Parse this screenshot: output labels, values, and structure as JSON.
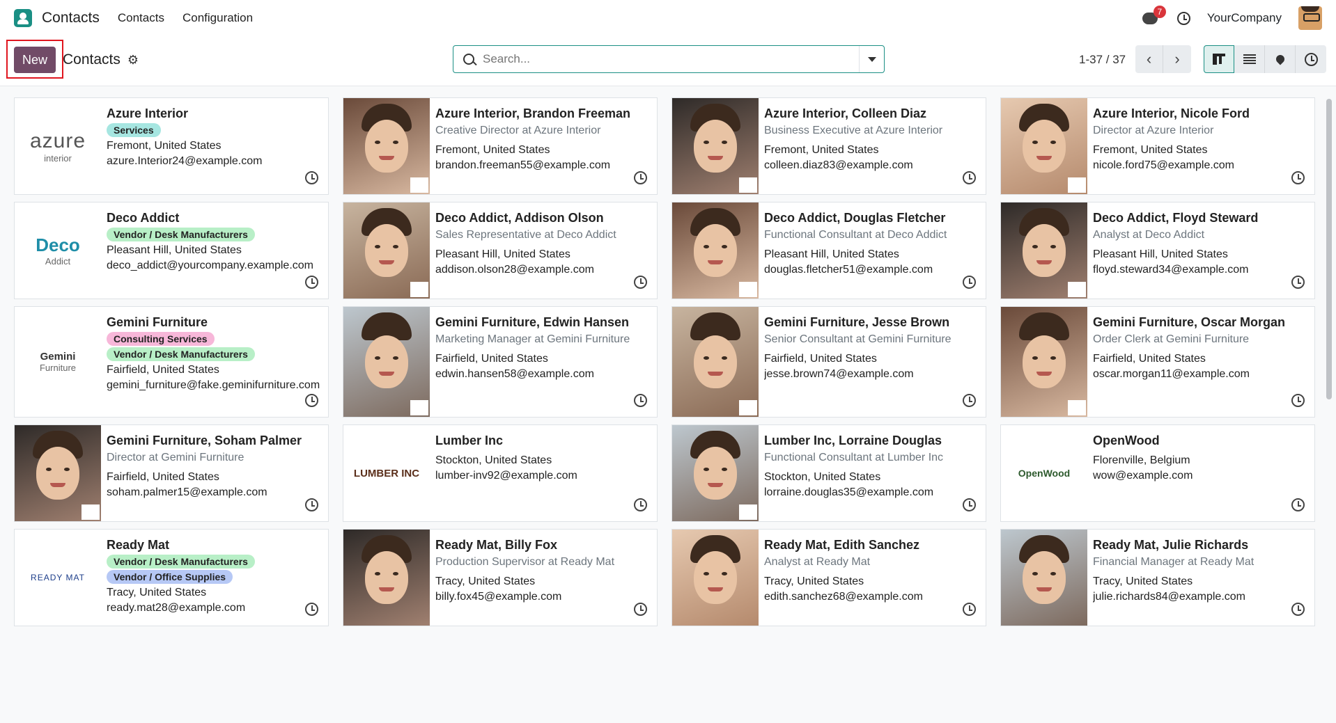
{
  "app": {
    "name": "Contacts"
  },
  "nav": {
    "menu": [
      "Contacts",
      "Configuration"
    ],
    "message_count": "7",
    "company": "YourCompany"
  },
  "control": {
    "new_label": "New",
    "breadcrumb": "Contacts",
    "search_placeholder": "Search...",
    "pager": "1-37 / 37",
    "views": [
      "kanban",
      "list",
      "map",
      "activity"
    ],
    "active_view": "kanban"
  },
  "colors": {
    "brand": "#714b67",
    "accent": "#1a8f84",
    "tag_green": "#b8efc7",
    "tag_pink": "#f7b7d9",
    "tag_blue": "#b6c8f5"
  },
  "cards": [
    {
      "title": "Azure Interior",
      "subtitle": "",
      "tags": [
        {
          "label": "Services",
          "color": "#a6e6e1"
        }
      ],
      "location": "Fremont, United States",
      "email": "azure.Interior24@example.com",
      "image": "azure-logo"
    },
    {
      "title": "Azure Interior, Brandon Freeman",
      "subtitle": "Creative Director at Azure Interior",
      "tags": [],
      "location": "Fremont, United States",
      "email": "brandon.freeman55@example.com",
      "image": "photo",
      "chip": "azure"
    },
    {
      "title": "Azure Interior, Colleen Diaz",
      "subtitle": "Business Executive at Azure Interior",
      "tags": [],
      "location": "Fremont, United States",
      "email": "colleen.diaz83@example.com",
      "image": "photo",
      "chip": "azure"
    },
    {
      "title": "Azure Interior, Nicole Ford",
      "subtitle": "Director at Azure Interior",
      "tags": [],
      "location": "Fremont, United States",
      "email": "nicole.ford75@example.com",
      "image": "photo",
      "chip": "azure"
    },
    {
      "title": "Deco Addict",
      "subtitle": "",
      "tags": [
        {
          "label": "Vendor / Desk Manufacturers",
          "color": "#b8efc7"
        }
      ],
      "location": "Pleasant Hill, United States",
      "email": "deco_addict@yourcompany.example.com",
      "image": "deco-logo"
    },
    {
      "title": "Deco Addict, Addison Olson",
      "subtitle": "Sales Representative at Deco Addict",
      "tags": [],
      "location": "Pleasant Hill, United States",
      "email": "addison.olson28@example.com",
      "image": "photo",
      "chip": "deco"
    },
    {
      "title": "Deco Addict, Douglas Fletcher",
      "subtitle": "Functional Consultant at Deco Addict",
      "tags": [],
      "location": "Pleasant Hill, United States",
      "email": "douglas.fletcher51@example.com",
      "image": "photo",
      "chip": "deco"
    },
    {
      "title": "Deco Addict, Floyd Steward",
      "subtitle": "Analyst at Deco Addict",
      "tags": [],
      "location": "Pleasant Hill, United States",
      "email": "floyd.steward34@example.com",
      "image": "photo",
      "chip": "deco"
    },
    {
      "title": "Gemini Furniture",
      "subtitle": "",
      "tags": [
        {
          "label": "Consulting Services",
          "color": "#f7b7d9"
        },
        {
          "label": "Vendor / Desk Manufacturers",
          "color": "#b8efc7"
        }
      ],
      "location": "Fairfield, United States",
      "email": "gemini_furniture@fake.geminifurniture.com",
      "image": "gemini-logo"
    },
    {
      "title": "Gemini Furniture, Edwin Hansen",
      "subtitle": "Marketing Manager at Gemini Furniture",
      "tags": [],
      "location": "Fairfield, United States",
      "email": "edwin.hansen58@example.com",
      "image": "photo",
      "chip": "gemini"
    },
    {
      "title": "Gemini Furniture, Jesse Brown",
      "subtitle": "Senior Consultant at Gemini Furniture",
      "tags": [],
      "location": "Fairfield, United States",
      "email": "jesse.brown74@example.com",
      "image": "photo",
      "chip": "gemini"
    },
    {
      "title": "Gemini Furniture, Oscar Morgan",
      "subtitle": "Order Clerk at Gemini Furniture",
      "tags": [],
      "location": "Fairfield, United States",
      "email": "oscar.morgan11@example.com",
      "image": "photo",
      "chip": "gemini"
    },
    {
      "title": "Gemini Furniture, Soham Palmer",
      "subtitle": "Director at Gemini Furniture",
      "tags": [],
      "location": "Fairfield, United States",
      "email": "soham.palmer15@example.com",
      "image": "photo",
      "chip": "gemini"
    },
    {
      "title": "Lumber Inc",
      "subtitle": "",
      "tags": [],
      "location": "Stockton, United States",
      "email": "lumber-inv92@example.com",
      "image": "lumber-logo"
    },
    {
      "title": "Lumber Inc, Lorraine Douglas",
      "subtitle": "Functional Consultant at Lumber Inc",
      "tags": [],
      "location": "Stockton, United States",
      "email": "lorraine.douglas35@example.com",
      "image": "photo",
      "chip": "lumber"
    },
    {
      "title": "OpenWood",
      "subtitle": "",
      "tags": [],
      "location": "Florenville, Belgium",
      "email": "wow@example.com",
      "image": "openwood-logo"
    },
    {
      "title": "Ready Mat",
      "subtitle": "",
      "tags": [
        {
          "label": "Vendor / Desk Manufacturers",
          "color": "#b8efc7"
        },
        {
          "label": "Vendor / Office Supplies",
          "color": "#b6c8f5"
        }
      ],
      "location": "Tracy, United States",
      "email": "ready.mat28@example.com",
      "image": "readymat-logo"
    },
    {
      "title": "Ready Mat, Billy Fox",
      "subtitle": "Production Supervisor at Ready Mat",
      "tags": [],
      "location": "Tracy, United States",
      "email": "billy.fox45@example.com",
      "image": "photo",
      "chip": ""
    },
    {
      "title": "Ready Mat, Edith Sanchez",
      "subtitle": "Analyst at Ready Mat",
      "tags": [],
      "location": "Tracy, United States",
      "email": "edith.sanchez68@example.com",
      "image": "photo",
      "chip": ""
    },
    {
      "title": "Ready Mat, Julie Richards",
      "subtitle": "Financial Manager at Ready Mat",
      "tags": [],
      "location": "Tracy, United States",
      "email": "julie.richards84@example.com",
      "image": "photo",
      "chip": ""
    }
  ],
  "logos": {
    "azure": {
      "main": "azure",
      "sub": "interior"
    },
    "deco": {
      "main": "Deco",
      "sub": "Addict"
    },
    "gemini": {
      "main": "Gemini",
      "sub": "Furniture"
    },
    "lumber": {
      "main": "LUMBER INC"
    },
    "openwood": {
      "main": "OpenWood"
    },
    "readymat": {
      "main": "READY MAT"
    }
  }
}
